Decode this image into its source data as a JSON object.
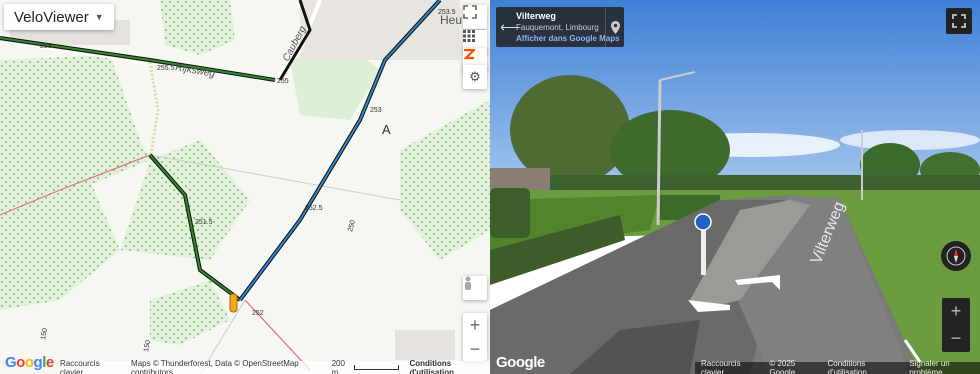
{
  "map": {
    "type_button": "VeloViewer",
    "place_labels": [
      "Heu",
      "Rijksweg",
      "Cauberg"
    ],
    "elevation_labels": [
      "256",
      "255.5",
      "255",
      "253.5",
      "253",
      "252.5",
      "251.5",
      "252",
      "250",
      "150",
      "150"
    ],
    "letter_marker": "A",
    "zoom_in": "+",
    "zoom_out": "−",
    "footer": {
      "keyboard": "Raccourcis clavier",
      "attribution": "Maps © Thunderforest, Data © OpenStreetMap contributors",
      "scale": "200 m",
      "terms": "Conditions d'utilisation"
    }
  },
  "streetview": {
    "title": "Vilterweg",
    "subtitle": "Fauquemont, Limbourg",
    "maps_link": "Afficher dans Google Maps",
    "road_label": "Vilterweg",
    "zoom_in": "+",
    "zoom_out": "−",
    "footer": {
      "keyboard": "Raccourcis clavier",
      "copyright": "© 2025 Google",
      "terms": "Conditions d'utilisation",
      "report": "Signaler un problème"
    }
  },
  "google_logo": [
    "G",
    "o",
    "o",
    "g",
    "l",
    "e"
  ],
  "colors": {
    "route_green": "#1d6b1d",
    "route_blue": "#1f5fa0",
    "forest": "#cfe8c7",
    "sky": "#5c9ae0"
  }
}
